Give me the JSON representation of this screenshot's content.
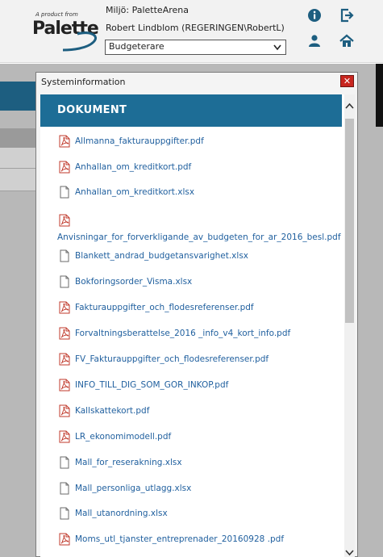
{
  "header": {
    "logo_tagline": "A product from",
    "logo_name": "Palette",
    "environment": "Miljö: PaletteArena",
    "user": "Robert Lindblom (REGERINGEN\\RobertL)",
    "role_selected": "Budgeterare",
    "icons": [
      "info-icon",
      "logout-icon",
      "user-icon",
      "home-icon"
    ],
    "accent_color": "#1d6d96"
  },
  "dialog": {
    "title": "Systeminformation",
    "close_label": "✕",
    "section_title": "DOKUMENT",
    "documents": [
      {
        "name": "Allmanna_fakturauppgifter.pdf",
        "type": "pdf"
      },
      {
        "name": "Anhallan_om_kreditkort.pdf",
        "type": "pdf"
      },
      {
        "name": "Anhallan_om_kreditkort.xlsx",
        "type": "file"
      },
      {
        "name": "Anvisningar_for_forverkligande_av_budgeten_for_ar_2016_besl.pdf",
        "type": "pdf"
      },
      {
        "name": "Blankett_andrad_budgetansvarighet.xlsx",
        "type": "file"
      },
      {
        "name": "Bokforingsorder_Visma.xlsx",
        "type": "file"
      },
      {
        "name": "Fakturauppgifter_och_flodesreferenser.pdf",
        "type": "pdf"
      },
      {
        "name": "Forvaltningsberattelse_2016 _info_v4_kort_info.pdf",
        "type": "pdf"
      },
      {
        "name": "FV_Fakturauppgifter_och_flodesreferenser.pdf",
        "type": "pdf"
      },
      {
        "name": "INFO_TILL_DIG_SOM_GOR_INKOP.pdf",
        "type": "pdf"
      },
      {
        "name": "Kallskattekort.pdf",
        "type": "pdf"
      },
      {
        "name": "LR_ekonomimodell.pdf",
        "type": "pdf"
      },
      {
        "name": "Mall_for_reserakning.xlsx",
        "type": "file"
      },
      {
        "name": "Mall_personliga_utlagg.xlsx",
        "type": "file"
      },
      {
        "name": "Mall_utanordning.xlsx",
        "type": "file"
      },
      {
        "name": "Moms_utl_tjanster_entreprenader_20160928 .pdf",
        "type": "pdf"
      }
    ]
  }
}
